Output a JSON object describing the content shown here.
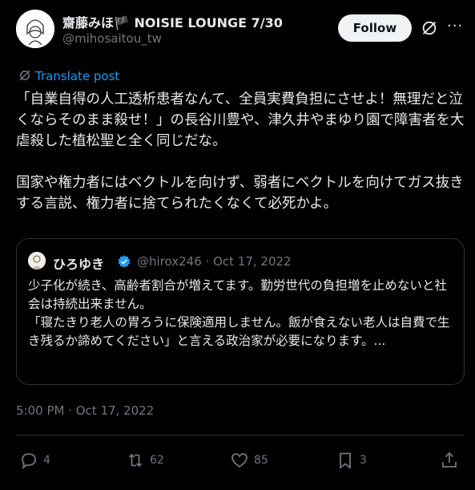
{
  "author": {
    "name": "齋藤みほ🏴 NOISIE LOUNGE 7/30",
    "handle": "@mihosaitou_tw",
    "follow_label": "Follow"
  },
  "translate_label": "Translate post",
  "body": {
    "paragraph1": "「自業自得の人工透析患者なんて、全員実費負担にさせよ！無理だと泣くならそのまま殺せ！」の長谷川豊や、津久井やまゆり園で障害者を大虐殺した植松聖と全く同じだな。",
    "paragraph2": "国家や権力者にはベクトルを向けず、弱者にベクトルを向けてガス抜きする言説、権力者に捨てられたくなくて必死かよ。"
  },
  "quote": {
    "name": "ひろゆき",
    "handle": "@hirox246",
    "separator": "·",
    "date": "Oct 17, 2022",
    "text1": "少子化が続き、高齢者割合が増えてます。勤労世代の負担増を止めないと社会は持続出来ません。",
    "text2": "「寝たきり老人の胃ろうに保険適用しません。飯が食えない老人は自費で生き残るか諦めてください」と言える政治家が必要になります。..."
  },
  "timestamp": "5:00 PM · Oct 17, 2022",
  "actions": {
    "replies": "4",
    "reposts": "62",
    "likes": "85",
    "bookmarks": "3"
  },
  "colors": {
    "background": "#000000",
    "accent": "#1d9bf0",
    "secondary_text": "#71767b",
    "border": "#2f3336"
  }
}
